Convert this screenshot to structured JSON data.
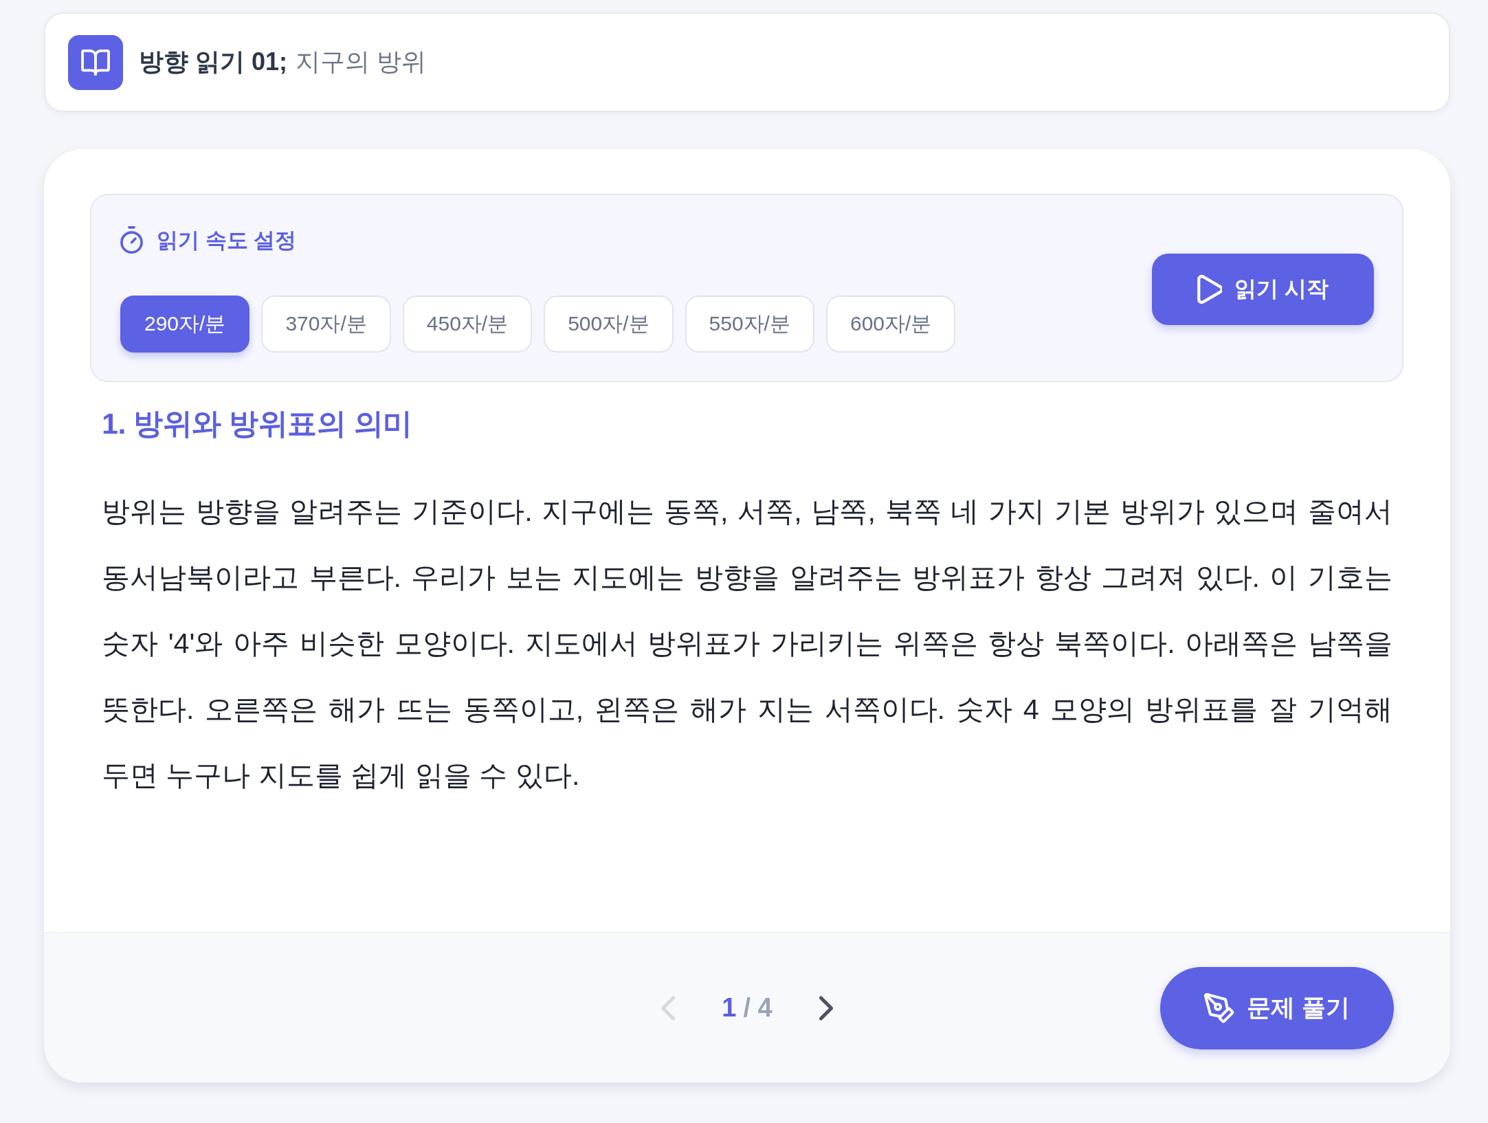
{
  "header": {
    "title": "방향 읽기 01;",
    "subtitle": "지구의 방위"
  },
  "speed_panel": {
    "title": "읽기 속도 설정",
    "options": [
      {
        "label": "290자/분",
        "selected": true
      },
      {
        "label": "370자/분",
        "selected": false
      },
      {
        "label": "450자/분",
        "selected": false
      },
      {
        "label": "500자/분",
        "selected": false
      },
      {
        "label": "550자/분",
        "selected": false
      },
      {
        "label": "600자/분",
        "selected": false
      }
    ],
    "start_button": "읽기 시작"
  },
  "section": {
    "heading": "1. 방위와 방위표의 의미",
    "paragraph": "방위는 방향을 알려주는 기준이다. 지구에는 동쪽, 서쪽, 남쪽, 북쪽 네 가지 기본 방위가 있으며 줄여서 동서남북이라고 부른다. 우리가 보는 지도에는 방향을 알려주는 방위표가 항상 그려져 있다. 이 기호는 숫자 '4'와 아주 비슷한 모양이다. 지도에서 방위표가 가리키는 위쪽은 항상 북쪽이다. 아래쪽은 남쪽을 뜻한다. 오른쪽은 해가 뜨는 동쪽이고, 왼쪽은 해가 지는 서쪽이다. 숫자 4 모양의 방위표를 잘 기억해 두면 누구나 지도를 쉽게 읽을 수 있다."
  },
  "footer": {
    "prev": {
      "disabled": true
    },
    "page": {
      "current": "1",
      "total": "/ 4"
    },
    "next": {
      "disabled": false
    },
    "quiz_button": "문제 풀기"
  }
}
